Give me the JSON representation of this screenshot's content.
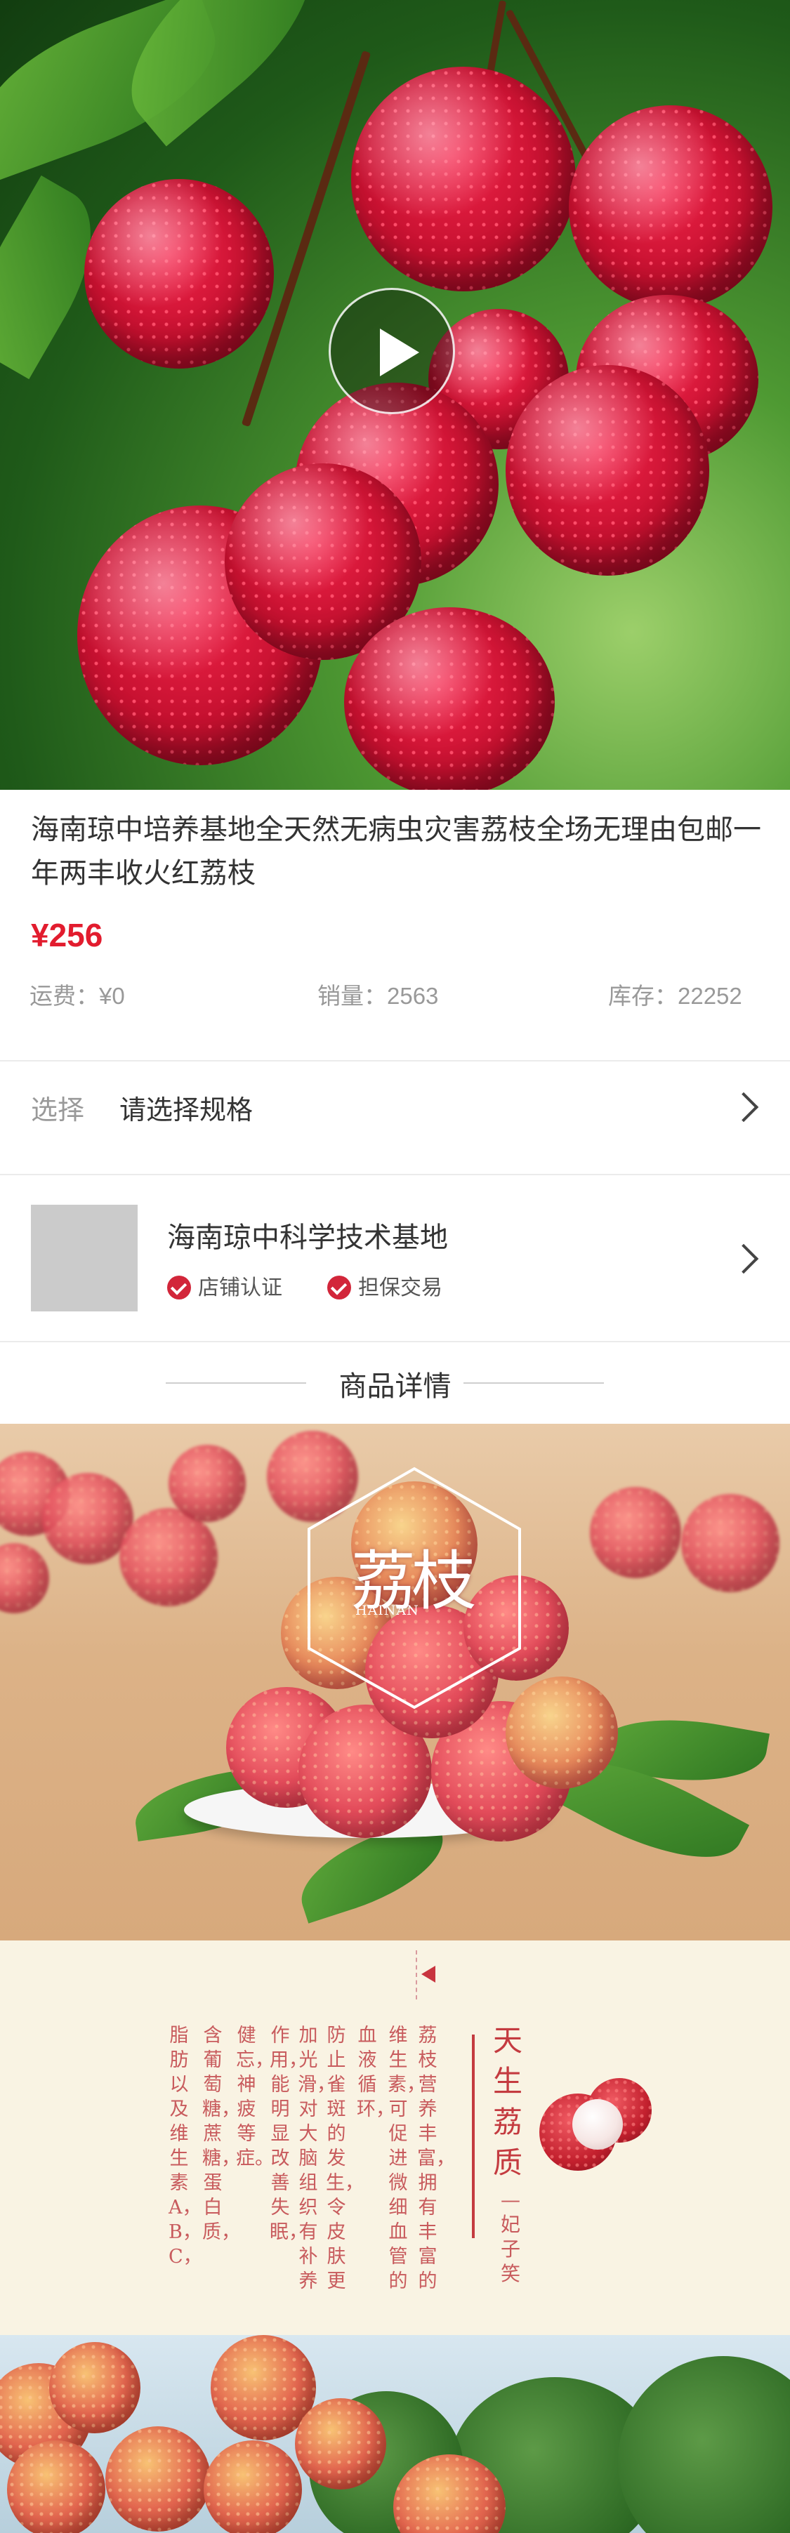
{
  "product": {
    "title": "海南琼中培养基地全天然无病虫灾害荔枝全场无理由包邮一年两丰收火红荔枝",
    "price": "¥256",
    "shipping": "运费：¥0",
    "sales": "销量：2563",
    "stock": "库存：22252"
  },
  "spec": {
    "label": "选择",
    "value": "请选择规格"
  },
  "shop": {
    "name": "海南琼中科学技术基地",
    "badges": [
      "店铺认证",
      "担保交易"
    ]
  },
  "details": {
    "heading": "商品详情",
    "image1": {
      "title_cn": "荔枝",
      "title_en": "HAINAN"
    },
    "poem": {
      "title": "天生荔质",
      "subtitle": "—妃子笑",
      "columns": [
        "荔枝营养丰富，拥有丰富的",
        "维生素，可促进微细血管的",
        "血液循环，",
        "防止雀斑的发生，令皮肤更",
        "加光滑，对大脑组织有补养",
        "作用，能明显改善失眠，",
        "健忘，神疲等症。",
        "含葡萄糖，蔗糖，蛋白质，",
        "脂肪以及维生素A，B，C，"
      ]
    }
  },
  "colors": {
    "price_red": "#e21c2e",
    "badge_red": "#d2263a",
    "poem_red": "#c43b40"
  },
  "icons": {
    "play": "play-icon",
    "chevron": "chevron-right-icon",
    "check": "check-circle-icon"
  }
}
